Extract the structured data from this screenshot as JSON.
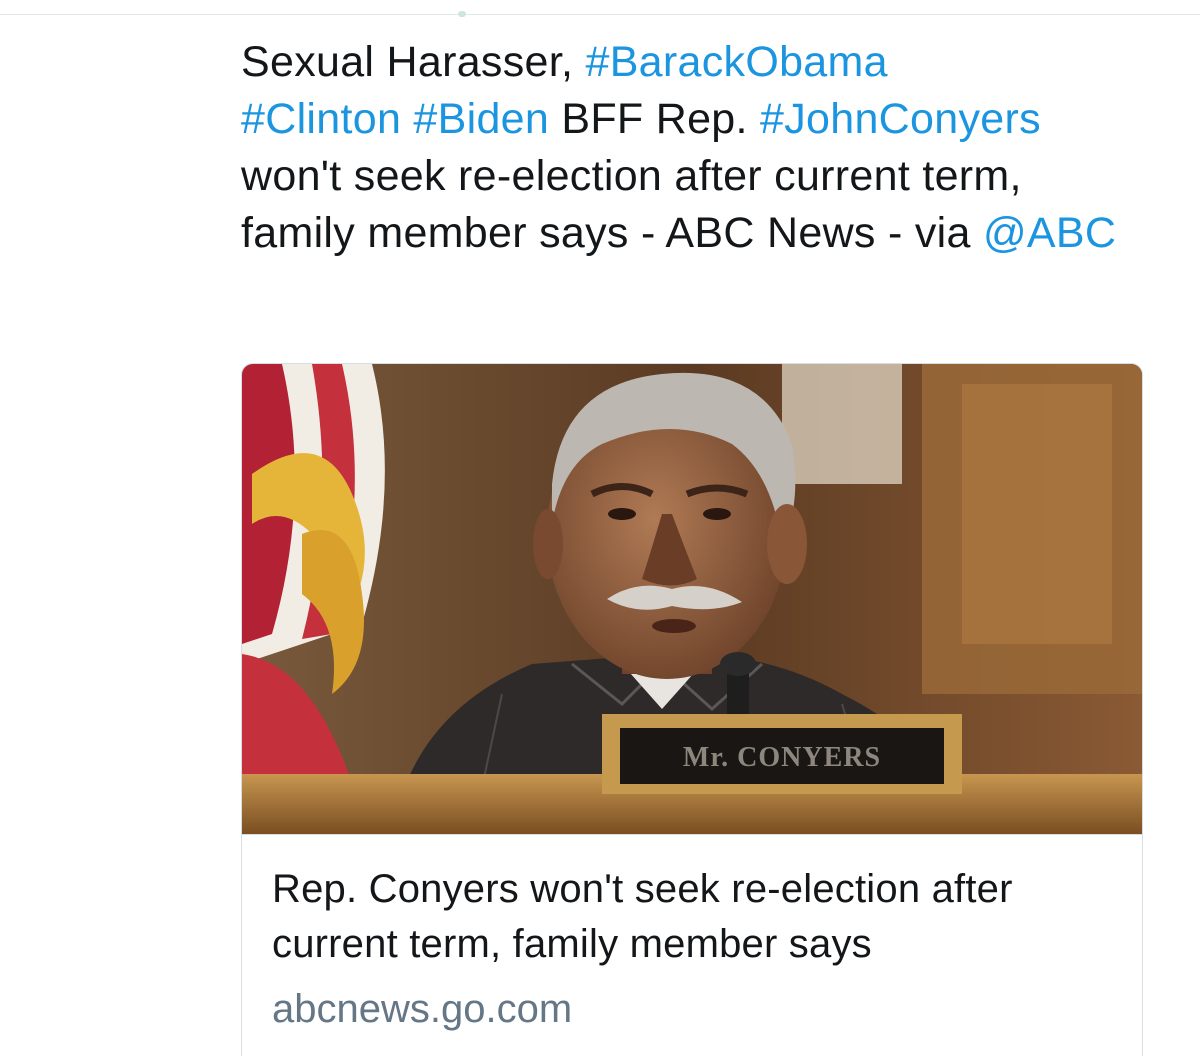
{
  "tweet": {
    "segments": [
      {
        "text": "Sexual Harasser, ",
        "link": false
      },
      {
        "text": "#BarackObama",
        "link": true
      },
      {
        "text": " ",
        "link": false
      },
      {
        "text": "#Clinton",
        "link": true
      },
      {
        "text": " ",
        "link": false
      },
      {
        "text": "#Biden",
        "link": true
      },
      {
        "text": " BFF Rep. ",
        "link": false
      },
      {
        "text": "#JohnConyers",
        "link": true
      },
      {
        "text": " won't seek re-election after current term, family member says - ABC News - via ",
        "link": false
      },
      {
        "text": "@ABC",
        "link": true
      }
    ]
  },
  "card": {
    "image_name": "conyers-photo",
    "nameplate_text": "Mr. CONYERS",
    "title": "Rep. Conyers won't seek re-election after current term, family member says",
    "domain": "abcnews.go.com"
  },
  "colors": {
    "link": "#1b95e0",
    "text": "#14171a",
    "domain": "#657786",
    "card_border": "#d6dde3"
  }
}
